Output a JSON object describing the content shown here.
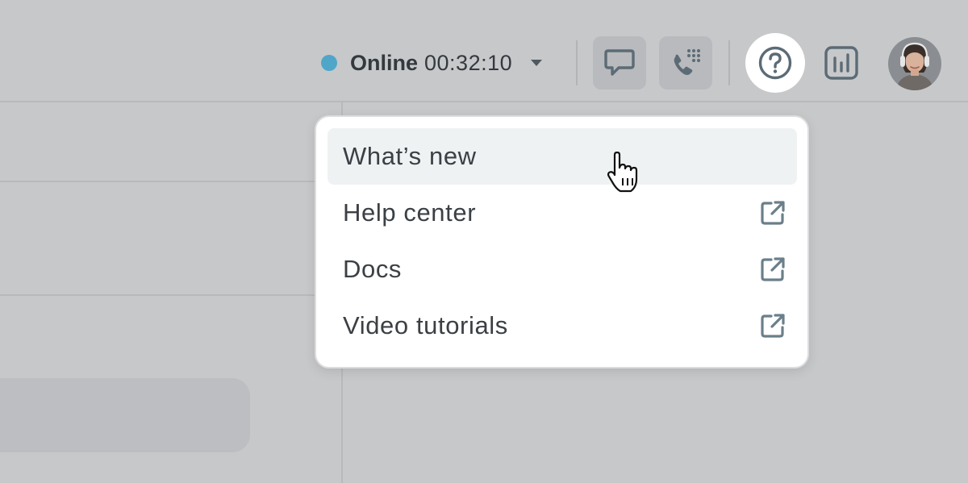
{
  "status": {
    "label": "Online",
    "timer": "00:32:10",
    "dot_color": "#4fa6c9",
    "caret_icon": "caret-down-icon"
  },
  "toolbar": {
    "icons": [
      "chat-bubble-icon",
      "dialpad-phone-icon",
      "help-circle-icon",
      "reports-chart-icon"
    ],
    "active_icon": "help-circle-icon"
  },
  "user": {
    "avatar_icon": "user-avatar"
  },
  "help_menu": {
    "items": [
      {
        "label": "What’s new",
        "external": false,
        "hovered": true
      },
      {
        "label": "Help center",
        "external": true,
        "icon": "external-link-icon"
      },
      {
        "label": "Docs",
        "external": true,
        "icon": "external-link-icon"
      },
      {
        "label": "Video tutorials",
        "external": true,
        "icon": "external-link-icon"
      }
    ]
  }
}
